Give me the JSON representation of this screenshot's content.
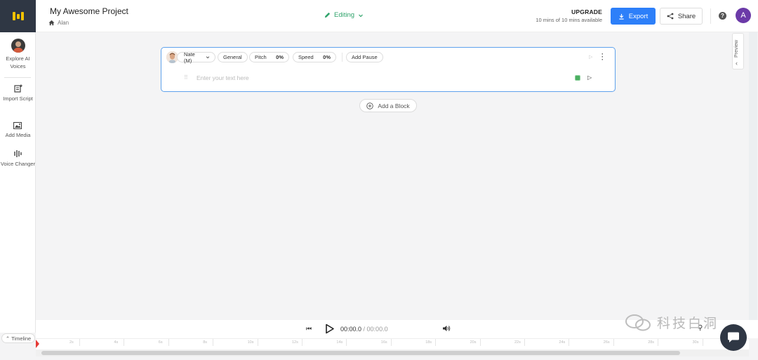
{
  "header": {
    "project_title": "My Awesome Project",
    "breadcrumb": "Alan",
    "mode_label": "Editing",
    "upgrade_label": "UPGRADE",
    "usage_text": "10 mins of 10 mins available",
    "export_label": "Export",
    "share_label": "Share",
    "help_glyph": "?",
    "avatar_initial": "A"
  },
  "sidebar": {
    "items": [
      {
        "label": "Explore AI Voices",
        "icon": "voice-avatar-icon"
      },
      {
        "label": "Import Script",
        "icon": "import-script-icon"
      },
      {
        "label": "Add Media",
        "icon": "media-icon"
      },
      {
        "label": "Voice Changer",
        "icon": "voice-changer-icon"
      }
    ]
  },
  "preview": {
    "label": "Preview"
  },
  "block": {
    "voice_name": "Nate (M)",
    "style_label": "General",
    "pitch_label": "Pitch",
    "pitch_value": "0%",
    "speed_label": "Speed",
    "speed_value": "0%",
    "add_pause_label": "Add Pause",
    "text_placeholder": "Enter your text here",
    "text_value": ""
  },
  "add_block_label": "Add a Block",
  "player": {
    "current_time": "00:00.0",
    "separator": " / ",
    "total_time": "00:00.0"
  },
  "timeline": {
    "toggle_label": "Timeline",
    "ticks": [
      "2s",
      "4s",
      "6s",
      "8s",
      "10s",
      "12s",
      "14s",
      "16s",
      "18s",
      "20s",
      "22s",
      "24s",
      "26s",
      "28s",
      "30s"
    ]
  },
  "watermark": {
    "text": "科技白洞"
  },
  "colors": {
    "accent": "#2d7ff9",
    "editing": "#2fa36b",
    "sidebar_logo_bg": "#2f3744",
    "avatar": "#6b3aa8",
    "block_border": "#5fa2ec",
    "playhead": "#e53935"
  }
}
